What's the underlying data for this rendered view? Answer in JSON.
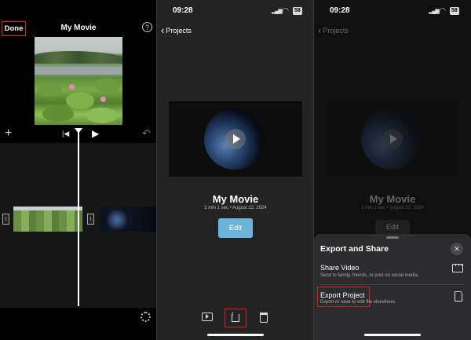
{
  "panel1": {
    "done_label": "Done",
    "title": "My Movie",
    "help_glyph": "?",
    "plus_glyph": "+",
    "skip_glyph": "|◀",
    "play_glyph": "▶",
    "undo_glyph": "↶",
    "handle_glyph": "I"
  },
  "panel2": {
    "status_time": "09:28",
    "battery": "58",
    "back_label": "Projects",
    "movie_title": "My Movie",
    "movie_meta": "1 min 1 sec • August 22, 2024",
    "edit_label": "Edit"
  },
  "panel3": {
    "status_time": "09:28",
    "battery": "58",
    "back_label": "Projects",
    "movie_title": "My Movie",
    "movie_meta": "1 min 1 sec • August 22, 2024",
    "edit_label": "Edit",
    "sheet": {
      "title": "Export and Share",
      "close_glyph": "✕",
      "options": [
        {
          "title": "Share Video",
          "subtitle": "Send to family, friends, or post on social media.",
          "icon": "film-icon"
        },
        {
          "title": "Export Project",
          "subtitle": "Export or save to edit file elsewhere.",
          "icon": "document-icon"
        }
      ]
    }
  },
  "colors": {
    "highlight": "#d81e1e",
    "edit_button": "#6eb4d8",
    "sheet_bg": "#2c2c2e"
  }
}
